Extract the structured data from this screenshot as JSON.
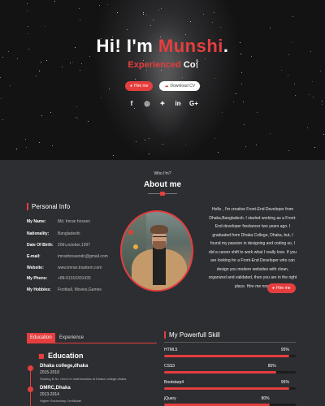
{
  "hero": {
    "greeting": "Hi! I'm ",
    "name": "Munshi",
    "name_suffix": ".",
    "typed_prefix": "Experienced",
    "typed_suffix": "Co",
    "hire_label": "Hire me",
    "download_label": "Download CV",
    "socials": [
      {
        "icon": "facebook-icon",
        "glyph": "f"
      },
      {
        "icon": "instagram-icon",
        "glyph": "◎"
      },
      {
        "icon": "twitter-icon",
        "glyph": "✦"
      },
      {
        "icon": "linkedin-icon",
        "glyph": "in"
      },
      {
        "icon": "google-plus-icon",
        "glyph": "G+"
      }
    ]
  },
  "about": {
    "pretitle": "Who I'm?",
    "title": "About me",
    "personal_info_title": "Personal Info",
    "info": [
      {
        "key": "My Name:",
        "value": "Md. Imran hossen"
      },
      {
        "key": "Nationality:",
        "value": "Bangladeshi"
      },
      {
        "key": "Date Of Birth:",
        "value": "20th,october,1997"
      },
      {
        "key": "E-mail:",
        "value": "imranhossendc@gmail.com"
      },
      {
        "key": "Website:",
        "value": "www.imran.trasitem.com"
      },
      {
        "key": "My Phone:",
        "value": "+88-01910301435"
      },
      {
        "key": "My Hobbies:",
        "value": "Football, Movies,Games"
      }
    ],
    "bio": "Hello , I'm creative Front-End Developer from Dhaka,Bangladesh. I started working as a Front-End developer freelancer two years ago. I graduated from Dhaka College, Dhaka, but, I found my passion in designing and coding so, I did a career shift to work what I really love. If you are looking for a Front-End Developer who can design you modern websites with clean, organized and validated, then you are in the right place. Hire me now!",
    "hire_label": "Hire me"
  },
  "education": {
    "tabs": [
      "Education",
      "Experience"
    ],
    "title": "Education",
    "items": [
      {
        "school": "Dhaka college,dhaka",
        "years": "2015-2019",
        "desc": "Studing B.Sc. Hon's in mathematics at Dhaka college,dhaka"
      },
      {
        "school": "DMRC,Dhaka",
        "years": "2013-2014",
        "desc": "Higher Secondary Certificate"
      }
    ]
  },
  "skills": {
    "title": "My Powerfull Skill",
    "items": [
      {
        "name": "HTML5",
        "percent": "95%",
        "level": 0.95
      },
      {
        "name": "CSS3",
        "percent": "85%",
        "level": 0.85
      },
      {
        "name": "Bootstarp4",
        "percent": "95%",
        "level": 0.95
      },
      {
        "name": "jQuery",
        "percent": "80%",
        "level": 0.8
      }
    ]
  },
  "colors": {
    "accent": "#e53e3e",
    "background": "#2d2e31"
  }
}
